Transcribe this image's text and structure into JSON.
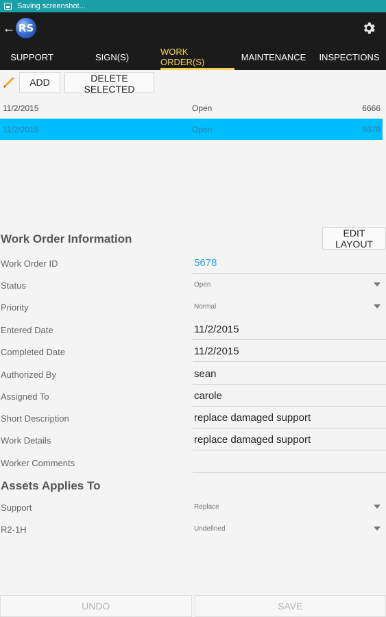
{
  "status_bar": {
    "text": "Saving screenshot..."
  },
  "app": {
    "logo_text": "RS",
    "back_icon": "arrow-left-icon",
    "settings_icon": "gear-icon"
  },
  "tabs": [
    {
      "label": "SUPPORT",
      "active": false
    },
    {
      "label": "SIGN(S)",
      "active": false
    },
    {
      "label": "WORK ORDER(S)",
      "active": true
    },
    {
      "label": "MAINTENANCE",
      "active": false
    },
    {
      "label": "INSPECTIONS",
      "active": false
    }
  ],
  "toolbar": {
    "edit_icon": "pencil-icon",
    "add_label": "ADD",
    "delete_label": "DELETE SELECTED"
  },
  "work_orders": [
    {
      "date": "11/2/2015",
      "status": "Open",
      "id": "6666",
      "selected": false
    },
    {
      "date": "11/2/2015",
      "status": "Open",
      "id": "5678",
      "selected": true
    }
  ],
  "info": {
    "title": "Work Order Information",
    "edit_layout_label": "EDIT LAYOUT",
    "fields": {
      "work_order_id": {
        "label": "Work Order ID",
        "value": "5678"
      },
      "status": {
        "label": "Status",
        "value": "Open"
      },
      "priority": {
        "label": "Priority",
        "value": "Normal"
      },
      "entered_date": {
        "label": "Entered Date",
        "value": "11/2/2015"
      },
      "completed_date": {
        "label": "Completed Date",
        "value": "11/2/2015"
      },
      "authorized_by": {
        "label": "Authorized By",
        "value": "sean"
      },
      "assigned_to": {
        "label": "Assigned To",
        "value": "carole"
      },
      "short_description": {
        "label": "Short Description",
        "value": "replace damaged support"
      },
      "work_details": {
        "label": "Work Details",
        "value": "replace damaged support"
      },
      "worker_comments": {
        "label": "Worker Comments",
        "value": ""
      }
    }
  },
  "assets": {
    "title": "Assets Applies To",
    "items": [
      {
        "label": "Support",
        "value": "Replace"
      },
      {
        "label": "R2-1H",
        "value": "Undefined"
      }
    ]
  },
  "bottom": {
    "undo_label": "UNDO",
    "save_label": "SAVE"
  },
  "colors": {
    "accent": "#f3d25a",
    "selection": "#00bfff",
    "link": "#2ba8e6",
    "status_bar": "#1a9fa7",
    "app_bar": "#1b1b1b"
  }
}
